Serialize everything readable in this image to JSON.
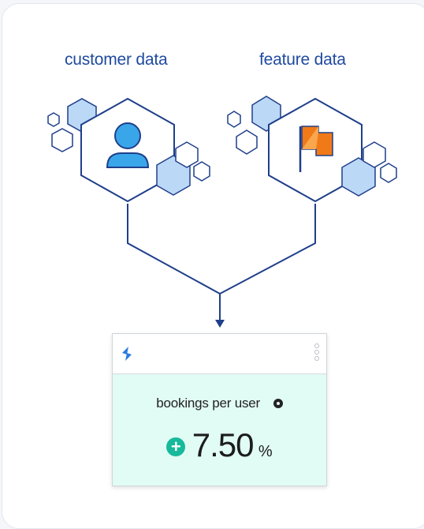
{
  "sources": [
    {
      "label": "customer data",
      "icon": "user-icon"
    },
    {
      "label": "feature data",
      "icon": "flag-icon"
    }
  ],
  "widget": {
    "logo": "statsig-logo-icon",
    "menu": "kebab-menu-icon",
    "metric_label": "bookings per user",
    "change_sign": "+",
    "value": "7.50",
    "unit": "%"
  },
  "colors": {
    "line": "#1f3f8a",
    "hex_fill": "#bcd8f7",
    "hex_stroke": "#1f3f8a",
    "user": "#3aa6ea",
    "flag": "#f07a18",
    "widget_body": "#e1fbf5",
    "positive": "#17b99b"
  }
}
